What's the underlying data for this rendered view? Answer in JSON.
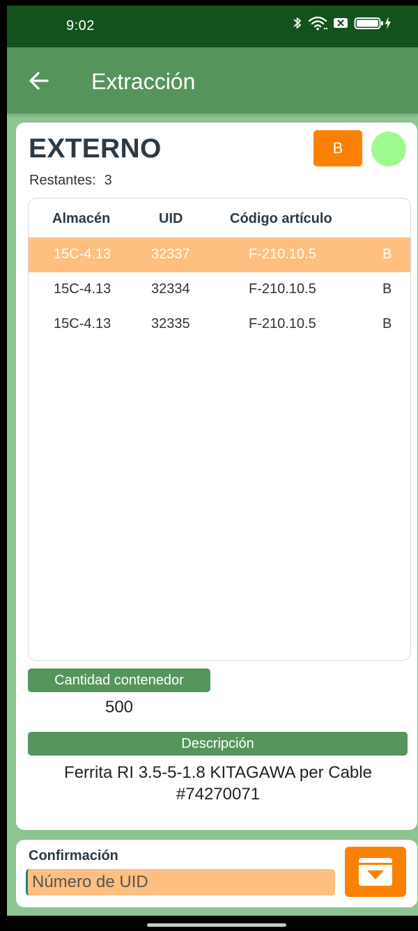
{
  "status_bar": {
    "time": "9:02",
    "icons": [
      "bluetooth-icon",
      "wifi-icon",
      "notification-icon",
      "battery-charging-icon"
    ]
  },
  "app_bar": {
    "back_icon": "arrow-left-icon",
    "title": "Extracción"
  },
  "header": {
    "title": "EXTERNO",
    "badge_label": "B",
    "status_dot_color": "#9cfb8c",
    "remaining_label": "Restantes:",
    "remaining_count": "3"
  },
  "table": {
    "columns": [
      "Almacén",
      "UID",
      "Código artículo"
    ],
    "rows": [
      {
        "almacen": "15C-4.13",
        "uid": "32337",
        "codigo": "F-210.10.5",
        "tipo": "B",
        "selected": true
      },
      {
        "almacen": "15C-4.13",
        "uid": "32334",
        "codigo": "F-210.10.5",
        "tipo": "B",
        "selected": false
      },
      {
        "almacen": "15C-4.13",
        "uid": "32335",
        "codigo": "F-210.10.5",
        "tipo": "B",
        "selected": false
      }
    ]
  },
  "details": {
    "quantity_label": "Cantidad contenedor",
    "quantity_value": "500",
    "description_label": "Descripción",
    "description_value": "Ferrita RI 3.5-5-1.8 KITAGAWA  per Cable #74270071"
  },
  "confirm": {
    "label": "Confirmación",
    "input_placeholder": "Número de UID",
    "input_value": "",
    "button_icon": "archive-download-icon"
  },
  "colors": {
    "status_bar": "#13521d",
    "app_bar": "#55955b",
    "background": "#8cc492",
    "accent_orange": "#fb8200",
    "selected_row": "#ffbf80",
    "heading_text": "#2c3a44"
  }
}
